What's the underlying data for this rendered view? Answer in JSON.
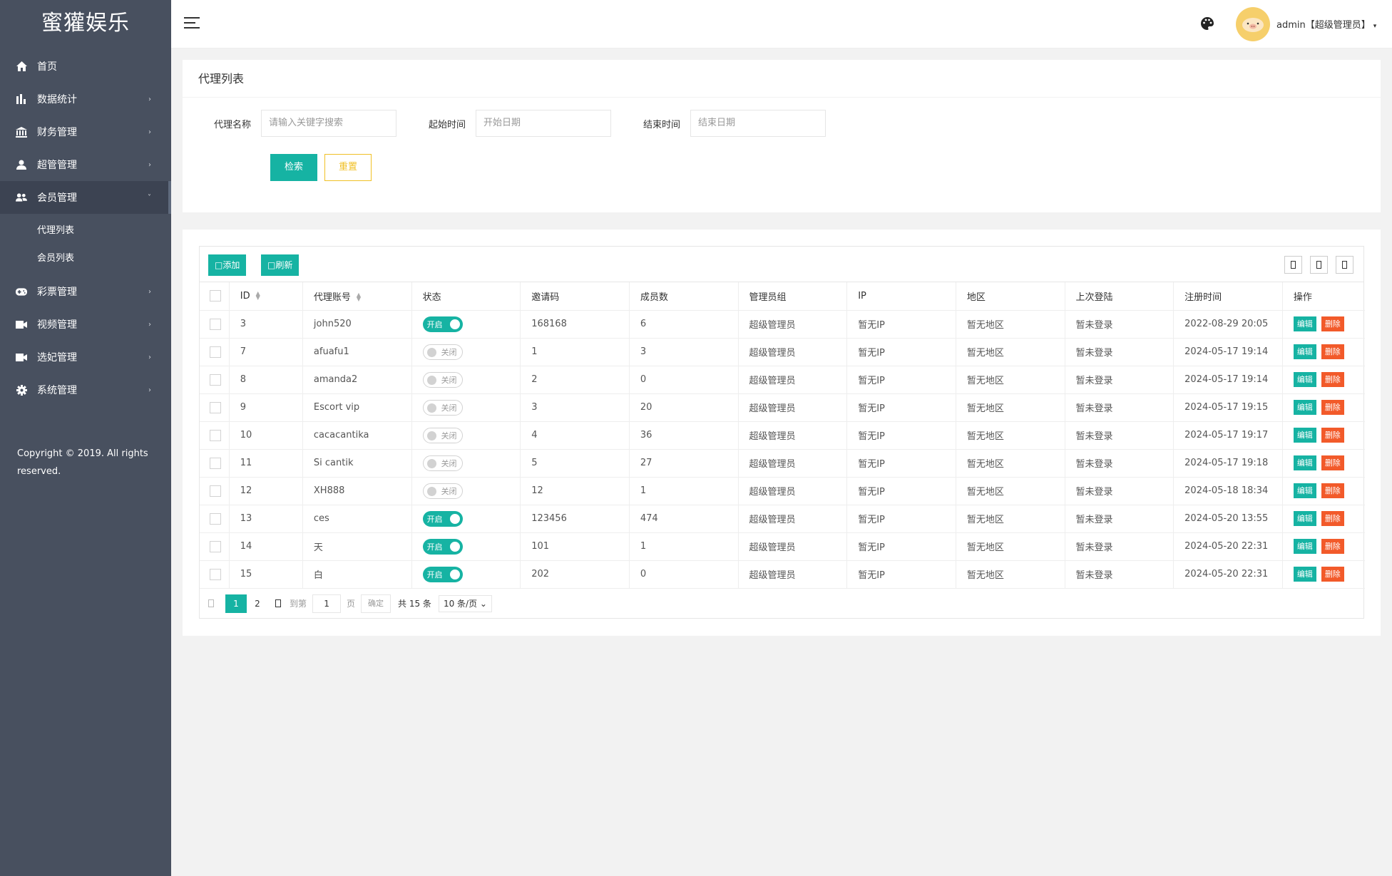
{
  "app": {
    "logo": "蜜獾娱乐"
  },
  "sidebar": {
    "items": [
      {
        "label": "首页",
        "icon": "home-icon",
        "arrow": ""
      },
      {
        "label": "数据统计",
        "icon": "bar-chart-icon",
        "arrow": "›"
      },
      {
        "label": "财务管理",
        "icon": "bank-icon",
        "arrow": "›"
      },
      {
        "label": "超管管理",
        "icon": "user-icon",
        "arrow": "›"
      },
      {
        "label": "会员管理",
        "icon": "users-icon",
        "arrow": "˅"
      },
      {
        "label": "彩票管理",
        "icon": "gamepad-icon",
        "arrow": "›"
      },
      {
        "label": "视频管理",
        "icon": "video-icon",
        "arrow": "›"
      },
      {
        "label": "选妃管理",
        "icon": "camera-icon",
        "arrow": "›"
      },
      {
        "label": "系统管理",
        "icon": "gear-icon",
        "arrow": "›"
      }
    ],
    "subitems": [
      "代理列表",
      "会员列表"
    ],
    "copyright": "Copyright © 2019. All rights reserved."
  },
  "header": {
    "user": "admin【超级管理员】",
    "caret": "▾"
  },
  "search": {
    "title": "代理列表",
    "name_label": "代理名称",
    "name_placeholder": "请输入关键字搜索",
    "start_label": "起始时间",
    "start_placeholder": "开始日期",
    "end_label": "结束时间",
    "end_placeholder": "结束日期",
    "search_btn": "检索",
    "reset_btn": "重置"
  },
  "toolbar": {
    "add": "添加",
    "refresh": "刷新",
    "add_icon": "□",
    "refresh_icon": "□"
  },
  "table": {
    "columns": [
      "",
      "ID",
      "代理账号",
      "状态",
      "邀请码",
      "成员数",
      "管理员组",
      "IP",
      "地区",
      "上次登陆",
      "注册时间",
      "操作"
    ],
    "switch_on": "开启",
    "switch_off": "关闭",
    "edit": "编辑",
    "delete": "删除",
    "rows": [
      {
        "id": "3",
        "account": "john520",
        "on": true,
        "code": "168168",
        "members": "6",
        "group": "超级管理员",
        "ip": "暂无IP",
        "region": "暂无地区",
        "last": "暂未登录",
        "reg": "2022-08-29 20:05"
      },
      {
        "id": "7",
        "account": "afuafu1",
        "on": false,
        "code": "1",
        "members": "3",
        "group": "超级管理员",
        "ip": "暂无IP",
        "region": "暂无地区",
        "last": "暂未登录",
        "reg": "2024-05-17 19:14"
      },
      {
        "id": "8",
        "account": "amanda2",
        "on": false,
        "code": "2",
        "members": "0",
        "group": "超级管理员",
        "ip": "暂无IP",
        "region": "暂无地区",
        "last": "暂未登录",
        "reg": "2024-05-17 19:14"
      },
      {
        "id": "9",
        "account": "Escort vip",
        "on": false,
        "code": "3",
        "members": "20",
        "group": "超级管理员",
        "ip": "暂无IP",
        "region": "暂无地区",
        "last": "暂未登录",
        "reg": "2024-05-17 19:15"
      },
      {
        "id": "10",
        "account": "cacacantika",
        "on": false,
        "code": "4",
        "members": "36",
        "group": "超级管理员",
        "ip": "暂无IP",
        "region": "暂无地区",
        "last": "暂未登录",
        "reg": "2024-05-17 19:17"
      },
      {
        "id": "11",
        "account": "Si cantik",
        "on": false,
        "code": "5",
        "members": "27",
        "group": "超级管理员",
        "ip": "暂无IP",
        "region": "暂无地区",
        "last": "暂未登录",
        "reg": "2024-05-17 19:18"
      },
      {
        "id": "12",
        "account": "XH888",
        "on": false,
        "code": "12",
        "members": "1",
        "group": "超级管理员",
        "ip": "暂无IP",
        "region": "暂无地区",
        "last": "暂未登录",
        "reg": "2024-05-18 18:34"
      },
      {
        "id": "13",
        "account": "ces",
        "on": true,
        "code": "123456",
        "members": "474",
        "group": "超级管理员",
        "ip": "暂无IP",
        "region": "暂无地区",
        "last": "暂未登录",
        "reg": "2024-05-20 13:55"
      },
      {
        "id": "14",
        "account": "天",
        "on": true,
        "code": "101",
        "members": "1",
        "group": "超级管理员",
        "ip": "暂无IP",
        "region": "暂无地区",
        "last": "暂未登录",
        "reg": "2024-05-20 22:31"
      },
      {
        "id": "15",
        "account": "白",
        "on": true,
        "code": "202",
        "members": "0",
        "group": "超级管理员",
        "ip": "暂无IP",
        "region": "暂无地区",
        "last": "暂未登录",
        "reg": "2024-05-20 22:31"
      }
    ]
  },
  "pager": {
    "current": "1",
    "next_page": "2",
    "goto_label": "到第",
    "goto_value": "1",
    "page_unit": "页",
    "confirm": "确定",
    "total": "共 15 条",
    "page_size": "10 条/页 ⌄"
  },
  "colors": {
    "accent": "#16b3a3",
    "danger": "#f25a2a",
    "warning": "#f0c026",
    "sidebar": "#48505f"
  }
}
